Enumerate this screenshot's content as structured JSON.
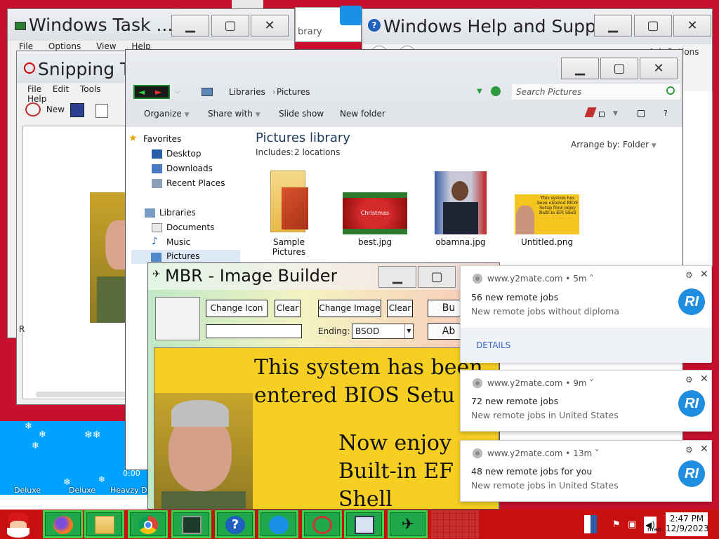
{
  "desktop": {
    "accent": "#c8102e",
    "snow_colors": [
      "#00a2ff",
      "#ffffff"
    ],
    "desktop_icon_labels": [
      "Deluxe",
      "Deluxe",
      "Heavzy De"
    ],
    "time_readout": "0:00"
  },
  "task_manager": {
    "title": "Windows Task ...",
    "menu": [
      "File",
      "Options",
      "View",
      "Help"
    ]
  },
  "help_window": {
    "title": "Windows Help and Supp...",
    "partial_text": "Ask  Options"
  },
  "partial_library_text": "brary",
  "snipping_tool": {
    "title": "Snipping To",
    "menu": [
      "File",
      "Edit",
      "Tools",
      "Help"
    ],
    "new_label": "New",
    "status_letter": "R"
  },
  "explorer": {
    "breadcrumb": [
      "Libraries",
      "Pictures"
    ],
    "search_placeholder": "Search Pictures",
    "toolbar": [
      "Organize",
      "Share with",
      "Slide show",
      "New folder"
    ],
    "nav": {
      "favorites": "Favorites",
      "desktop": "Desktop",
      "downloads": "Downloads",
      "recent": "Recent Places",
      "libraries": "Libraries",
      "documents": "Documents",
      "music": "Music",
      "pictures": "Pictures"
    },
    "library_title": "Pictures library",
    "includes_label": "Includes:",
    "includes_link": "2 locations",
    "arrange_label": "Arrange by:",
    "arrange_value": "Folder",
    "files": [
      {
        "name": "Sample Pictures",
        "icon": "folder-icon"
      },
      {
        "name": "best.jpg",
        "icon": "christmas-image"
      },
      {
        "name": "obamna.jpg",
        "icon": "portrait-image"
      },
      {
        "name": "Untitled.png",
        "icon": "bios-meme-image"
      }
    ],
    "untitled_thumb_text": "This system has been entered BIOS Setup Now enjoy Built-in EFI Shell"
  },
  "mbr": {
    "title": "MBR - Image Builder",
    "change_icon": "Change Icon",
    "clear1": "Clear",
    "change_image": "Change Image",
    "clear2": "Clear",
    "btn_bu": "Bu",
    "btn_ab": "Ab",
    "ending_label": "Ending:",
    "ending_value": "BSOD",
    "preview_line1": "This system has been",
    "preview_line2": "entered BIOS Setu",
    "preview_line3": "Now enjoy",
    "preview_line4": "Built-in EF",
    "preview_line5": "Shell"
  },
  "notifications": [
    {
      "source": "www.y2mate.com",
      "age": "5m",
      "title": "56 new remote jobs",
      "body": "New remote jobs without diploma",
      "badge": "RI",
      "details": "DETAILS"
    },
    {
      "source": "www.y2mate.com",
      "age": "9m",
      "title": "72 new remote jobs",
      "body": "New remote jobs in United States",
      "badge": "RI"
    },
    {
      "source": "www.y2mate.com",
      "age": "13m",
      "title": "48 new remote jobs for you",
      "body": "New remote jobs in United States",
      "badge": "RI"
    }
  ],
  "taskbar": {
    "time": "2:47 PM",
    "date": "12/9/2023",
    "icons": [
      "santa-start-icon",
      "firefox-icon",
      "file-explorer-icon",
      "chrome-icon",
      "task-manager-icon",
      "help-icon",
      "chat-icon",
      "snipping-tool-icon",
      "network-computer-icon",
      "mbr-builder-icon"
    ],
    "partial_label": "mao"
  }
}
